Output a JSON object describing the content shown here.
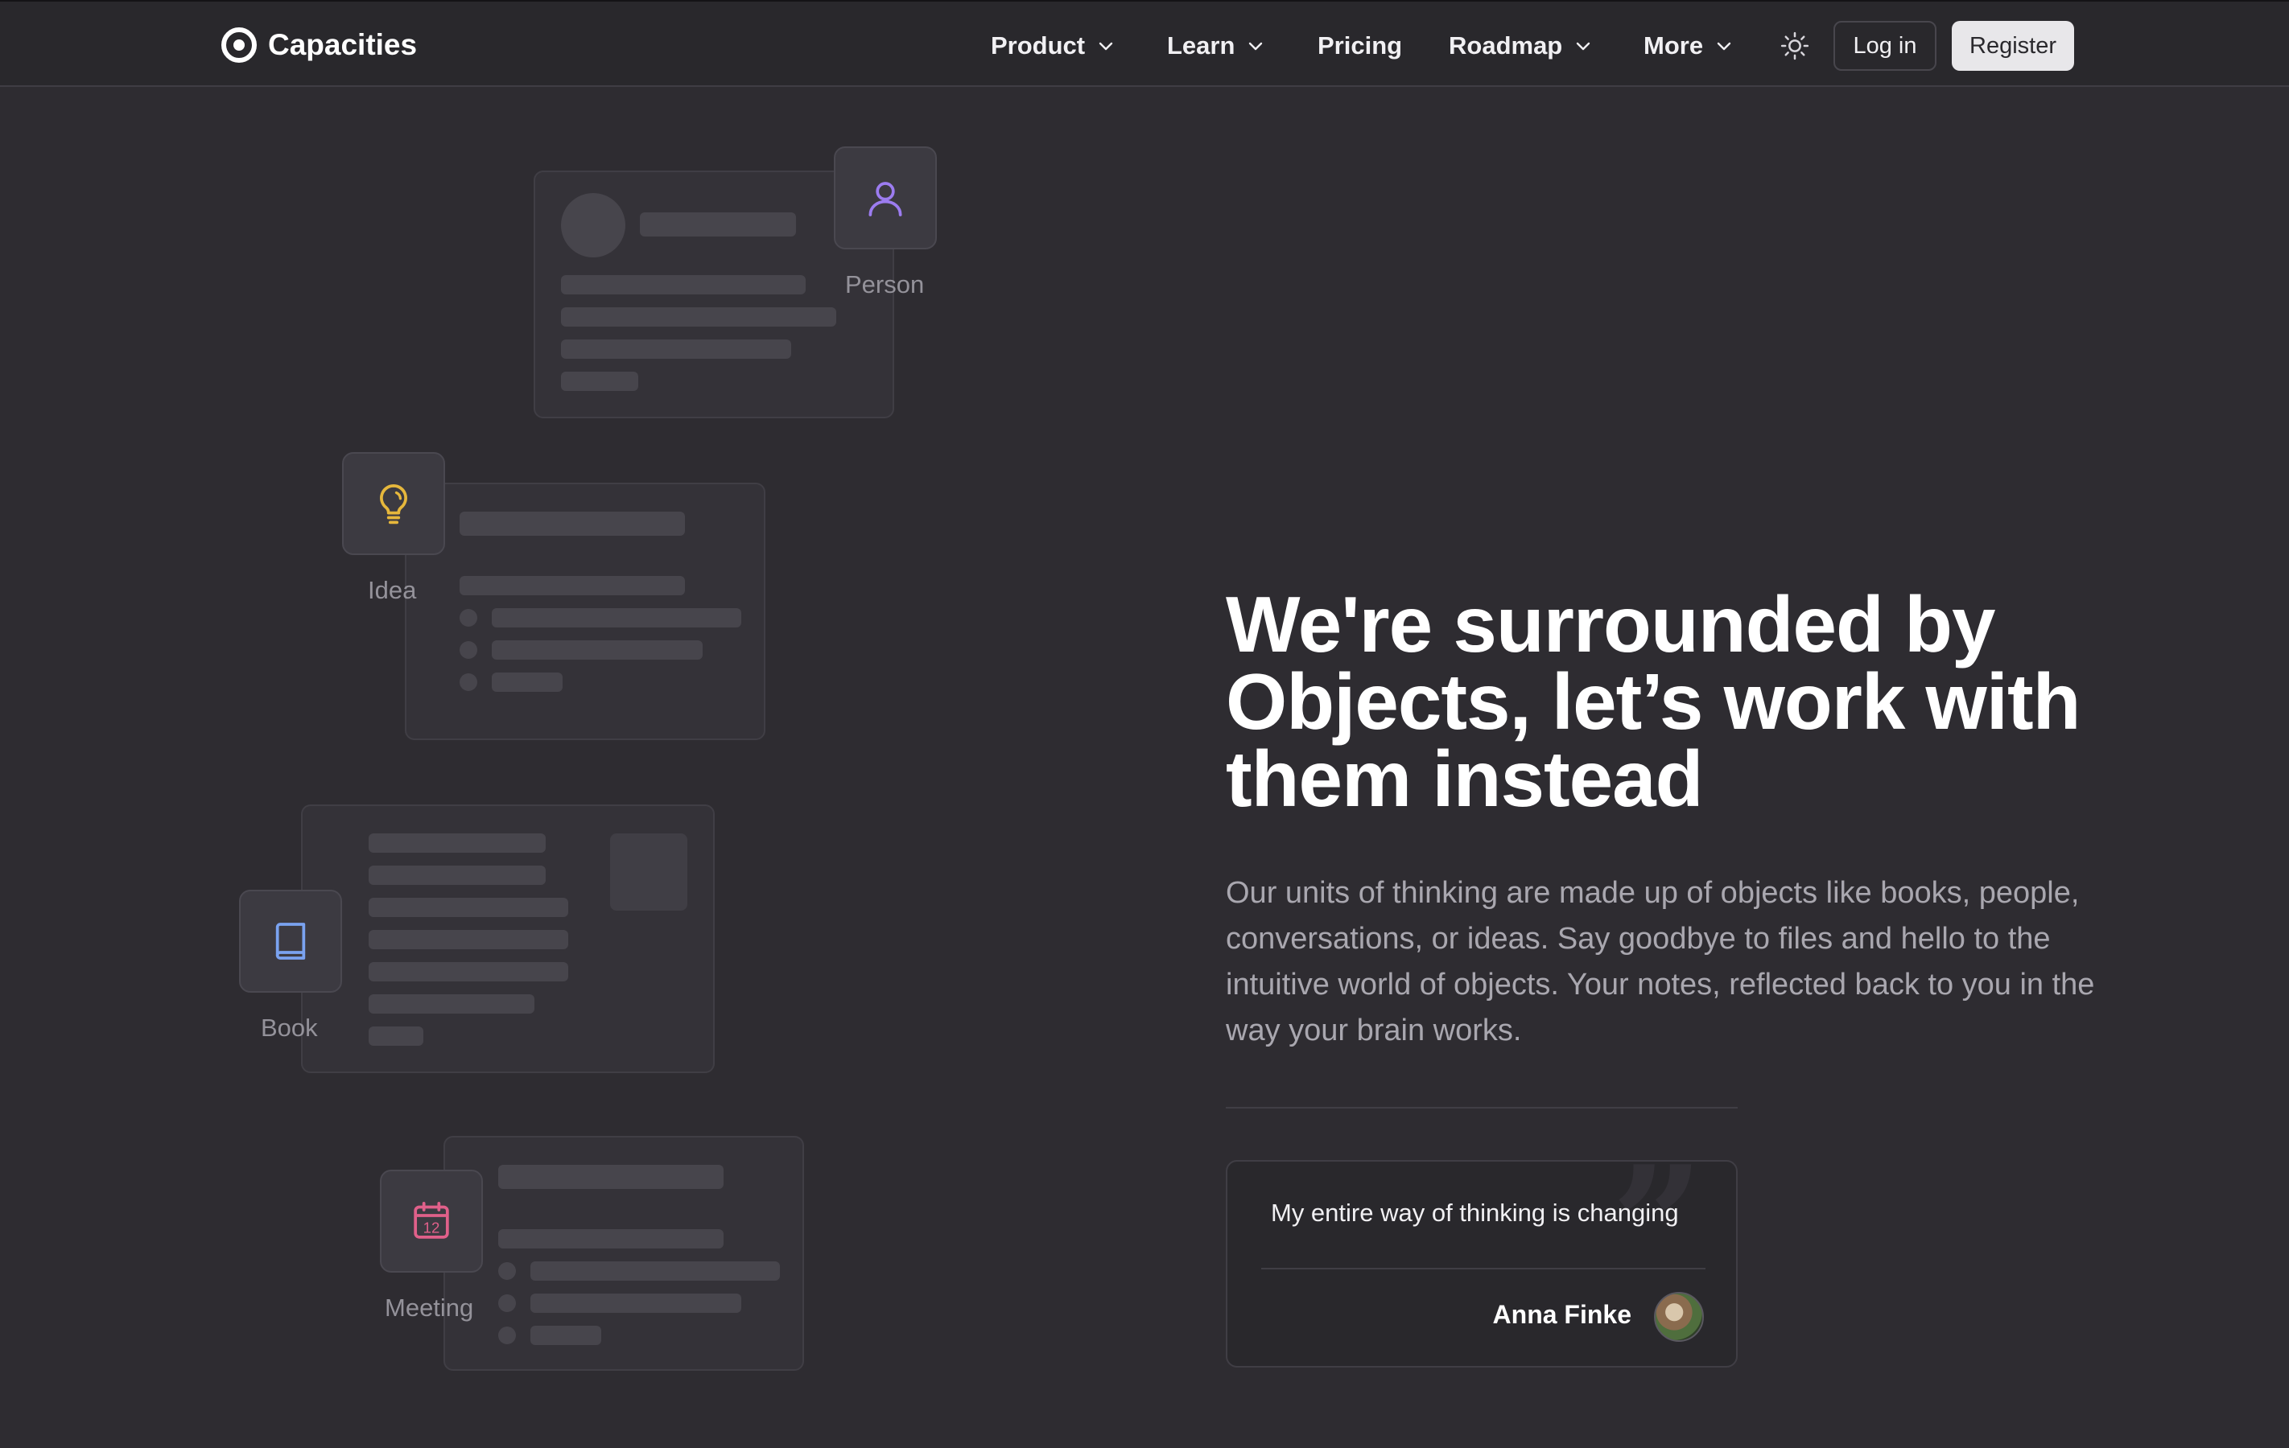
{
  "nav": {
    "brand": "Capacities",
    "items": [
      {
        "label": "Product",
        "has_dropdown": true
      },
      {
        "label": "Learn",
        "has_dropdown": true
      },
      {
        "label": "Pricing",
        "has_dropdown": false
      },
      {
        "label": "Roadmap",
        "has_dropdown": true
      },
      {
        "label": "More",
        "has_dropdown": true
      }
    ],
    "login_label": "Log in",
    "register_label": "Register"
  },
  "objects": {
    "person_label": "Person",
    "idea_label": "Idea",
    "book_label": "Book",
    "meeting_label": "Meeting",
    "meeting_day": "12"
  },
  "hero": {
    "headline": "We're surrounded by Objects, let’s work with them instead",
    "lead": "Our units of thinking are made up of objects like books, people, conversations, or ideas. Say goodbye to files and hello to the intuitive world of objects. Your notes, reflected back to you in the way your brain works."
  },
  "testimonial": {
    "quote": "My entire way of thinking is changing",
    "author": "Anna Finke"
  },
  "colors": {
    "background": "#2e2c31",
    "nav_background": "#29282c",
    "person_accent": "#9c7cf0",
    "idea_accent": "#e6b73c",
    "book_accent": "#7aa2f0",
    "meeting_accent": "#e0608a"
  },
  "icons": {
    "person": "person-icon",
    "idea": "lightbulb-icon",
    "book": "book-icon",
    "meeting": "calendar-icon",
    "theme": "sun-icon"
  }
}
